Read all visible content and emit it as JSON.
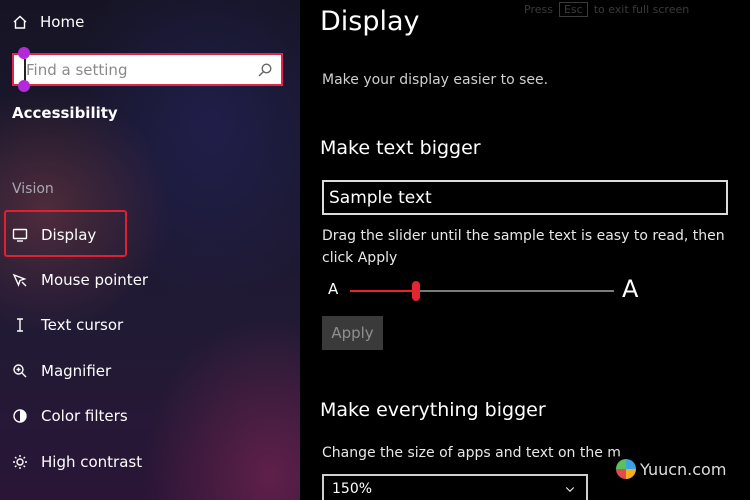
{
  "sidebar": {
    "home_label": "Home",
    "search_placeholder": "Find a setting",
    "section_title": "Accessibility",
    "group_title": "Vision",
    "items": [
      {
        "label": "Display",
        "icon": "monitor-icon"
      },
      {
        "label": "Mouse pointer",
        "icon": "mouse-pointer-icon"
      },
      {
        "label": "Text cursor",
        "icon": "text-cursor-icon"
      },
      {
        "label": "Magnifier",
        "icon": "magnifier-icon"
      },
      {
        "label": "Color filters",
        "icon": "color-filters-icon"
      },
      {
        "label": "High contrast",
        "icon": "high-contrast-icon"
      }
    ]
  },
  "main": {
    "title": "Display",
    "hint_prefix": "Press",
    "hint_key": "Esc",
    "hint_suffix": "to exit full screen",
    "subtitle": "Make your display easier to see.",
    "text_section": {
      "heading": "Make text bigger",
      "sample_text": "Sample text",
      "description": "Drag the slider until the sample text is easy to read, then click Apply",
      "slider_min_label": "A",
      "slider_max_label": "A",
      "slider_value": 0.25,
      "apply_label": "Apply"
    },
    "everything_section": {
      "heading": "Make everything bigger",
      "description": "Change the size of apps and text on the m",
      "selected_scale": "150%"
    }
  },
  "watermark": {
    "text": "Yuucn.com"
  },
  "colors": {
    "accent": "#e2262f",
    "highlight_border": "#e0202e",
    "search_border": "#e2264a"
  }
}
